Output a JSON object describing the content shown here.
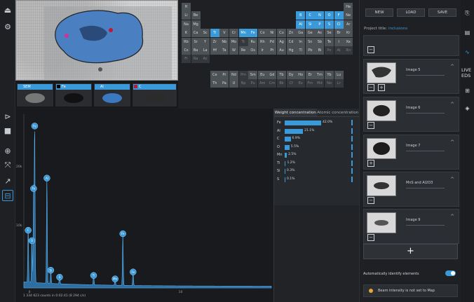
{
  "toolbar_top": {
    "icons": [
      "eject-icon",
      "settings-icon"
    ]
  },
  "toolbar_bottom": {
    "icons": [
      "play-icon",
      "stop-icon",
      "crosshair-icon",
      "expand-icon",
      "line-icon",
      "minus-box-icon"
    ]
  },
  "thumbnails": [
    {
      "label": "SEM",
      "color": "#3a9ad9"
    },
    {
      "label": "Fe",
      "color": "#000000"
    },
    {
      "label": "Al",
      "color": "#3a9ad9"
    },
    {
      "label": "C",
      "color": "#c01830"
    }
  ],
  "periodic": {
    "selected": [
      "B",
      "C",
      "N",
      "O",
      "F",
      "Al",
      "Si",
      "P",
      "S",
      "Cl",
      "Ti",
      "Mn",
      "Fe"
    ],
    "rows": [
      [
        "H",
        "",
        "",
        "",
        "",
        "",
        "",
        "",
        "",
        "",
        "",
        "",
        "",
        "",
        "",
        "",
        "",
        "He"
      ],
      [
        "Li",
        "Be",
        "",
        "",
        "",
        "",
        "",
        "",
        "",
        "",
        "",
        "",
        "B",
        "C",
        "N",
        "O",
        "F",
        "Ne"
      ],
      [
        "Na",
        "Mg",
        "",
        "",
        "",
        "",
        "",
        "",
        "",
        "",
        "",
        "",
        "Al",
        "Si",
        "P",
        "S",
        "Cl",
        "Ar"
      ],
      [
        "K",
        "Ca",
        "Sc",
        "Ti",
        "V",
        "Cr",
        "Mn",
        "Fe",
        "Co",
        "Ni",
        "Cu",
        "Zn",
        "Ga",
        "Ge",
        "As",
        "Se",
        "Br",
        "Kr"
      ],
      [
        "Rb",
        "Sr",
        "Y",
        "Zr",
        "Nb",
        "Mo",
        "Tc",
        "Ru",
        "Rh",
        "Pd",
        "Ag",
        "Cd",
        "In",
        "Sn",
        "Sb",
        "Te",
        "I",
        "Xe"
      ],
      [
        "Cs",
        "Ba",
        "La",
        "Hf",
        "Ta",
        "W",
        "Re",
        "Os",
        "Ir",
        "Pt",
        "Au",
        "Hg",
        "Tl",
        "Pb",
        "Bi",
        "Po",
        "At",
        "Rn"
      ],
      [
        "Fr",
        "Ra",
        "Ac",
        "",
        "",
        "",
        "",
        "",
        "",
        "",
        "",
        "",
        "",
        "",
        "",
        "",
        "",
        ""
      ]
    ],
    "lanth": [
      "Ce",
      "Pr",
      "Nd",
      "Pm",
      "Sm",
      "Eu",
      "Gd",
      "Tb",
      "Dy",
      "Ho",
      "Er",
      "Tm",
      "Yb",
      "Lu"
    ],
    "actin": [
      "Th",
      "Pa",
      "U",
      "Np",
      "Pu",
      "Am",
      "Cm",
      "Bk",
      "Cf",
      "Es",
      "Fm",
      "Md",
      "No",
      "Lr"
    ]
  },
  "concentration": {
    "tab_weight": "Weight concentration",
    "tab_atomic": "Atomic concentration",
    "rows": [
      {
        "el": "Fe",
        "value": 42.0,
        "label": "42.0%"
      },
      {
        "el": "Al",
        "value": 21.1,
        "label": "21.1%"
      },
      {
        "el": "C",
        "value": 6.9,
        "label": "6.9%"
      },
      {
        "el": "O",
        "value": 5.5,
        "label": "5.5%"
      },
      {
        "el": "Mn",
        "value": 2.5,
        "label": "2.5%"
      },
      {
        "el": "Ti",
        "value": 1.2,
        "label": "1.2%"
      },
      {
        "el": "Si",
        "value": 0.3,
        "label": "0.3%"
      },
      {
        "el": "S",
        "value": 0.1,
        "label": "0.1%"
      }
    ]
  },
  "spectrum": {
    "ylabels": [
      "20k",
      "10k"
    ],
    "xlabels": [
      "0",
      "10"
    ],
    "peaks": [
      {
        "label": "Fe",
        "x": 0.7,
        "h": 0.92
      },
      {
        "label": "Fe",
        "x": 0.63,
        "h": 0.56
      },
      {
        "label": "Al",
        "x": 1.49,
        "h": 0.62
      },
      {
        "label": "C",
        "x": 0.28,
        "h": 0.32
      },
      {
        "label": "O",
        "x": 0.52,
        "h": 0.26
      },
      {
        "label": "Si",
        "x": 1.74,
        "h": 0.09
      },
      {
        "label": "S",
        "x": 2.31,
        "h": 0.05
      },
      {
        "label": "Ti",
        "x": 4.51,
        "h": 0.06
      },
      {
        "label": "Mn",
        "x": 5.9,
        "h": 0.04
      },
      {
        "label": "Fe",
        "x": 6.4,
        "h": 0.3
      },
      {
        "label": "Fe",
        "x": 7.06,
        "h": 0.08
      }
    ],
    "status": "1 334 623 counts in 0:02:41 (8 294 c/s)"
  },
  "project": {
    "btn_new": "NEW",
    "btn_load": "LOAD",
    "btn_save": "SAVE",
    "title_label": "Project title:",
    "title_value": "inclusions",
    "images": [
      {
        "name": "Image 5"
      },
      {
        "name": "Image 6"
      },
      {
        "name": "Image 7"
      },
      {
        "name": "MnS and Al2O3"
      },
      {
        "name": "Image 9"
      }
    ],
    "add_label": "+",
    "auto_label": "Automatically identify elements",
    "warn_label": "Beam intensity is not set to Map"
  },
  "far": {
    "live_label": "LIVE EDS"
  }
}
